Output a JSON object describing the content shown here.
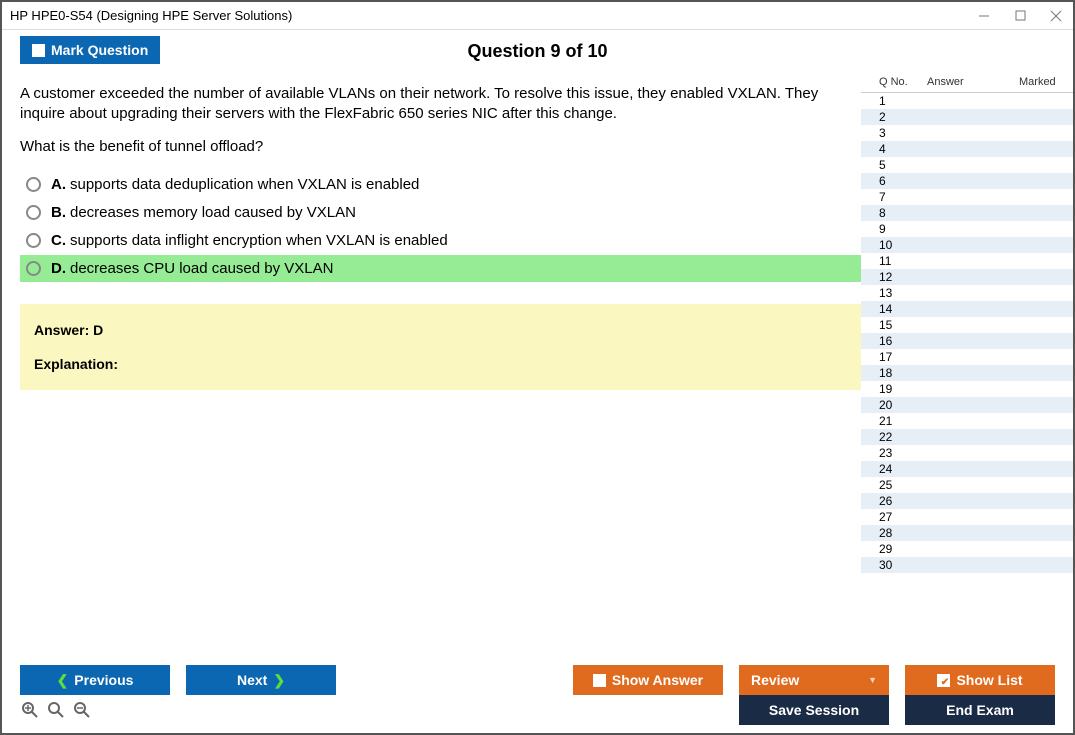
{
  "window": {
    "title": "HP HPE0-S54 (Designing HPE Server Solutions)"
  },
  "header": {
    "mark_label": "Mark Question",
    "question_label": "Question 9 of 10"
  },
  "question": {
    "para1": "A customer exceeded the number of available VLANs on their network. To resolve this issue, they enabled VXLAN. They inquire about upgrading their servers with the FlexFabric 650 series NIC after this change.",
    "para2": "What is the benefit of tunnel offload?"
  },
  "options": [
    {
      "letter": "A.",
      "text": "supports data deduplication when VXLAN is enabled",
      "selected": false
    },
    {
      "letter": "B.",
      "text": "decreases memory load caused by VXLAN",
      "selected": false
    },
    {
      "letter": "C.",
      "text": "supports data inflight encryption when VXLAN is enabled",
      "selected": false
    },
    {
      "letter": "D.",
      "text": "decreases CPU load caused by VXLAN",
      "selected": true
    }
  ],
  "answer_box": {
    "answer": "Answer: D",
    "explanation_label": "Explanation:"
  },
  "sidebar": {
    "head": {
      "qno": "Q No.",
      "answer": "Answer",
      "marked": "Marked"
    },
    "rows": [
      1,
      2,
      3,
      4,
      5,
      6,
      7,
      8,
      9,
      10,
      11,
      12,
      13,
      14,
      15,
      16,
      17,
      18,
      19,
      20,
      21,
      22,
      23,
      24,
      25,
      26,
      27,
      28,
      29,
      30
    ]
  },
  "footer": {
    "previous": "Previous",
    "next": "Next",
    "show_answer": "Show Answer",
    "review": "Review",
    "show_list": "Show List",
    "save_session": "Save Session",
    "end_exam": "End Exam"
  }
}
